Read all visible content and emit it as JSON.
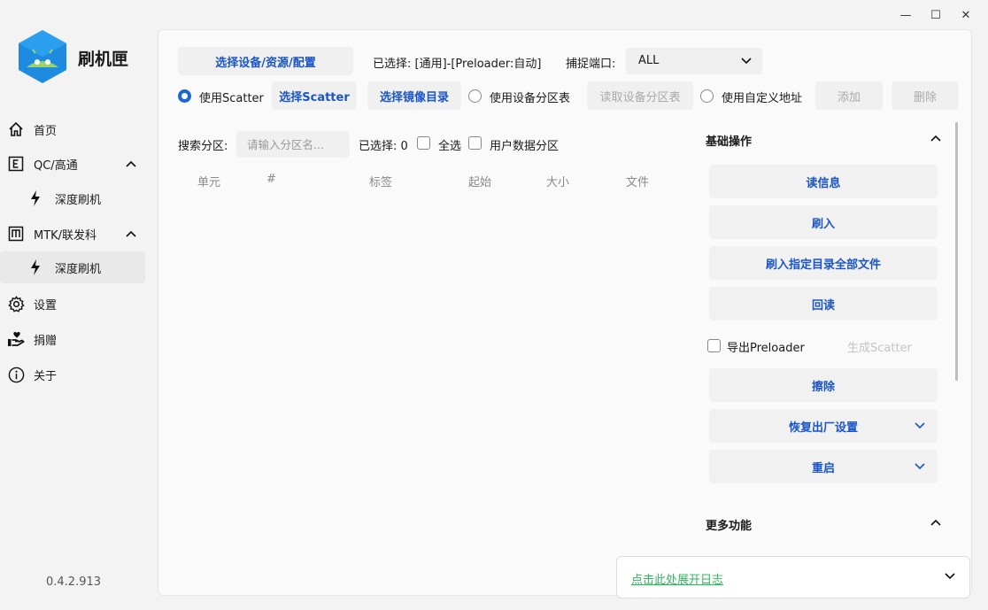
{
  "window": {
    "controls": {
      "minimize": "—",
      "maximize": "☐",
      "close": "✕"
    }
  },
  "app": {
    "name": "刷机匣",
    "version": "0.4.2.913"
  },
  "sidebar": {
    "items": [
      {
        "label": "首页",
        "icon": "home-icon"
      },
      {
        "label": "QC/高通",
        "icon": "letter-e-icon"
      },
      {
        "label": "深度刷机",
        "icon": "lightning-icon"
      },
      {
        "label": "MTK/联发科",
        "icon": "letter-m-icon"
      },
      {
        "label": "深度刷机",
        "icon": "lightning-icon"
      },
      {
        "label": "设置",
        "icon": "gear-icon"
      },
      {
        "label": "捐赠",
        "icon": "donate-hand-icon"
      },
      {
        "label": "关于",
        "icon": "info-icon"
      }
    ]
  },
  "toolbar": {
    "select_device_button": "选择设备/资源/配置",
    "selected_label": "已选择: [通用]-[Preloader:自动]",
    "port_label": "捕捉端口:",
    "port_value": "ALL",
    "use_scatter": "使用Scatter",
    "select_scatter_button": "选择Scatter",
    "select_image_dir_button": "选择镜像目录",
    "use_device_partition": "使用设备分区表",
    "read_partition_button": "读取设备分区表",
    "use_custom_address": "使用自定义地址",
    "add_button": "添加",
    "delete_button": "删除"
  },
  "filter": {
    "search_label": "搜索分区:",
    "search_placeholder": "请输入分区名...",
    "selected_count": "已选择: 0",
    "select_all": "全选",
    "user_data_partition": "用户数据分区"
  },
  "table": {
    "headers": [
      "单元",
      "#",
      "标签",
      "起始",
      "大小",
      "文件"
    ]
  },
  "basic_ops": {
    "title": "基础操作",
    "buttons": [
      "读信息",
      "刷入",
      "刷入指定目录全部文件",
      "回读"
    ],
    "export_preloader": "导出Preloader",
    "generate_scatter": "生成Scatter",
    "erase_button": "擦除",
    "factory_reset_button": "恢复出厂设置",
    "reboot_button": "重启"
  },
  "more_features": {
    "title": "更多功能"
  },
  "log": {
    "expand_link": "点击此处展开日志"
  }
}
